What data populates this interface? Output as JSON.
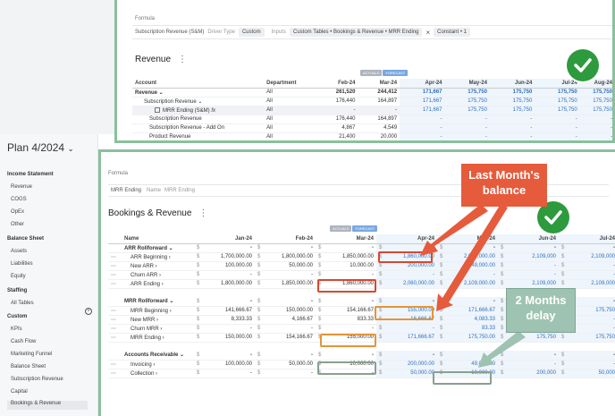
{
  "top_panel": {
    "formula_label": "Formula",
    "formula_bar": {
      "field": "Subscription Revenue (S&M)",
      "driver_type_label": "Driver Type",
      "driver_type_value": "Custom",
      "inputs_label": "Inputs",
      "inputs_value": "Custom Tables • Bookings & Revenue • MRR Ending",
      "operator": "×",
      "constant": "Constant • 1"
    },
    "title": "Revenue",
    "menu_glyph": "⋮",
    "badge_actuals": "ACTUALS",
    "badge_forecast": "FORECAST",
    "headers": [
      "Account",
      "Department",
      "Feb-24",
      "Mar-24",
      "Apr-24",
      "May-24",
      "Jun-24",
      "Jul-24",
      "Aug-24"
    ],
    "rows": [
      {
        "account": "Revenue",
        "dept": "All",
        "v": [
          "261,520",
          "244,412",
          "171,667",
          "175,750",
          "175,750",
          "175,750",
          "175,750"
        ]
      },
      {
        "account": "Subscription Revenue",
        "dept": "All",
        "v": [
          "176,440",
          "164,897",
          "171,667",
          "175,750",
          "175,750",
          "175,750",
          "175,750"
        ]
      },
      {
        "account": "MRR Ending (S&M)",
        "dept": "All",
        "v": [
          "-",
          "-",
          "171,667",
          "175,750",
          "175,750",
          "175,750",
          "175,750"
        ]
      },
      {
        "account": "Subscription Revenue",
        "dept": "All",
        "v": [
          "176,440",
          "164,897",
          "-",
          "-",
          "-",
          "-",
          "-"
        ]
      },
      {
        "account": "Subscription Revenue - Add On",
        "dept": "All",
        "v": [
          "4,867",
          "4,549",
          "-",
          "-",
          "-",
          "-",
          "-"
        ]
      },
      {
        "account": "Product Revenue",
        "dept": "All",
        "v": [
          "21,400",
          "20,000",
          "-",
          "-",
          "-",
          "-",
          "-"
        ]
      }
    ]
  },
  "sidebar": {
    "plan_title": "Plan 4/2024",
    "income_statement": {
      "heading": "Income Statement",
      "items": [
        "Revenue",
        "COGS",
        "OpEx",
        "Other"
      ]
    },
    "balance_sheet": {
      "heading": "Balance Sheet",
      "items": [
        "Assets",
        "Liabilities",
        "Equity"
      ]
    },
    "staffing": {
      "heading": "Staffing",
      "items": [
        "All Tables"
      ]
    },
    "custom": {
      "heading": "Custom",
      "items": [
        "KPIs",
        "Cash Flow",
        "Marketing Funnel",
        "Balance Sheet",
        "Subscription Revenue",
        "Capital",
        "Bookings & Revenue"
      ]
    }
  },
  "bottom_panel": {
    "formula_label": "Formula",
    "formula_bar": {
      "field": "MRR Ending",
      "name_label": "Name",
      "name_value": "MRR Ending"
    },
    "title": "Bookings & Revenue",
    "menu_glyph": "⋮",
    "badge_actuals": "ACTUALS",
    "badge_forecast": "FORECAST",
    "currency": "$",
    "headers": [
      "Name",
      "Jan-24",
      "Feb-24",
      "Mar-24",
      "Apr-24",
      "May-24",
      "Jun-24",
      "Jul-24"
    ],
    "groups": [
      {
        "name": "ARR Rollforward",
        "summary": [
          "-",
          "-",
          "-",
          "-",
          "-",
          "-",
          "-"
        ],
        "rows": [
          {
            "name": "ARR Beginning",
            "v": [
              "1,700,000.00",
              "1,800,000.00",
              "1,850,000.00",
              "1,860,000.00",
              "2,060,000.00",
              "2,109,000",
              "2,109,000"
            ]
          },
          {
            "name": "New ARR",
            "v": [
              "100,000.00",
              "50,000.00",
              "10,000.00",
              "200,000.00",
              "49,000.00",
              "-",
              "-"
            ]
          },
          {
            "name": "Churn ARR",
            "v": [
              "-",
              "-",
              "-",
              "-",
              "-",
              "-",
              "-"
            ]
          },
          {
            "name": "ARR Ending",
            "v": [
              "1,800,000.00",
              "1,850,000.00",
              "1,860,000.00",
              "2,060,000.00",
              "2,109,000.00",
              "2,109,000",
              "2,109,000"
            ]
          }
        ]
      },
      {
        "name": "MRR Rollforward",
        "summary": [
          "-",
          "-",
          "-",
          "-",
          "-",
          "-",
          "-"
        ],
        "rows": [
          {
            "name": "MRR Beginning",
            "v": [
              "141,666.67",
              "150,000.00",
              "154,166.67",
              "155,000.00",
              "171,666.67",
              "175,750",
              "175,750"
            ]
          },
          {
            "name": "New MRR",
            "v": [
              "8,333.33",
              "4,166.67",
              "833.33",
              "16,666.67",
              "4,083.33",
              "-",
              "-"
            ]
          },
          {
            "name": "Churn MRR",
            "v": [
              "-",
              "-",
              "-",
              "-",
              "83.33",
              "-",
              "-"
            ]
          },
          {
            "name": "MRR Ending",
            "v": [
              "150,000.00",
              "154,166.67",
              "155,000.00",
              "171,666.67",
              "175,750.00",
              "175,750",
              "175,750"
            ]
          }
        ]
      },
      {
        "name": "Accounts Receivable",
        "summary": [
          "-",
          "-",
          "-",
          "-",
          "-",
          "-",
          "-"
        ],
        "rows": [
          {
            "name": "Invoicing",
            "v": [
              "100,000.00",
              "50,000.00",
              "10,000.00",
              "200,000.00",
              "49,000.00",
              "-",
              "-"
            ]
          },
          {
            "name": "Collection",
            "v": [
              "-",
              "-",
              "-",
              "50,000.00",
              "10,000.00",
              "200,000",
              "50,000"
            ]
          }
        ]
      }
    ]
  },
  "callouts": {
    "last_month": "Last Month's balance",
    "delay": "2 Months delay"
  },
  "colors": {
    "check_green": "#2e9a3e",
    "panel_border": "#8cbf9b",
    "callout_red": "#e55b3c",
    "callout_green": "#9fc3b2",
    "forecast_blue": "#2f6fbf"
  }
}
